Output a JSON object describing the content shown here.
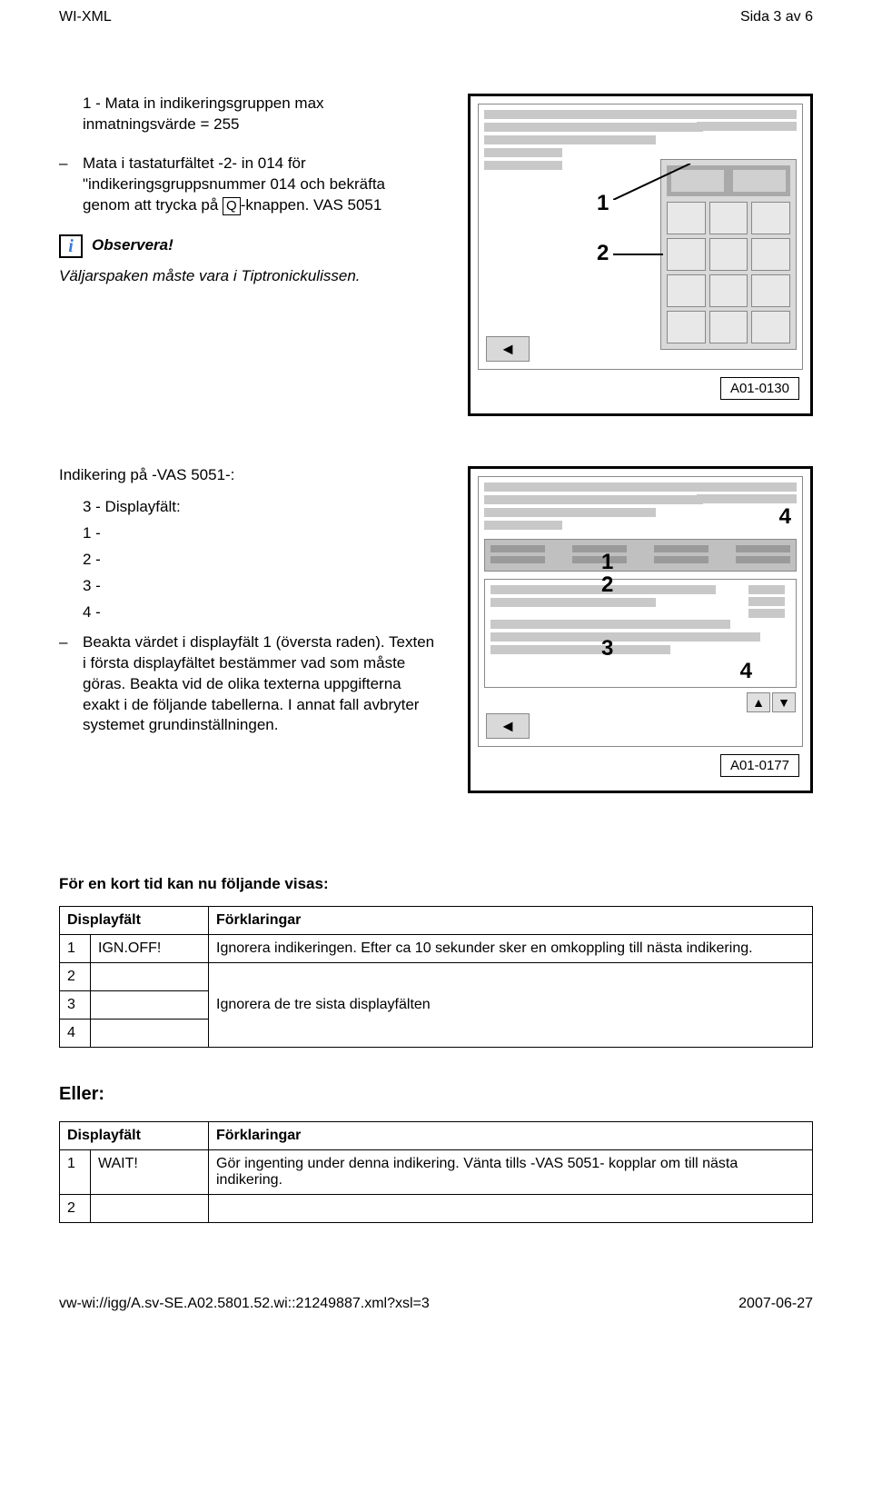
{
  "header": {
    "left": "WI-XML",
    "right": "Sida 3 av 6"
  },
  "block1": {
    "item1": "1 - Mata in indikeringsgruppen max inmatningsvärde = 255",
    "item2_pre": "Mata i tastaturfältet -2- in 014 för \"indikeringsgruppsnummer 014 och bekräfta genom att trycka på ",
    "item2_key": "Q",
    "item2_post": "-knappen. VAS 5051",
    "info_label": "Observera!",
    "info_note": "Väljarspaken måste vara i Tiptronickulissen."
  },
  "fig1_label": "A01-0130",
  "fig2_label": "A01-0177",
  "callout1": "1",
  "callout2": "2",
  "callout3": "3",
  "callout4": "4",
  "block2": {
    "heading": "Indikering på -VAS 5051-:",
    "lines": [
      "3 - Displayfält:",
      "1 -",
      "2 -",
      "3 -",
      "4 -"
    ],
    "para": "Beakta värdet i displayfält 1 (översta raden). Texten i första displayfältet bestämmer vad som måste göras. Beakta vid de olika texterna uppgifterna exakt i de följande tabellerna. I annat fall avbryter systemet grundinställningen."
  },
  "table1": {
    "heading": "För en kort tid kan nu följande visas:",
    "col1": "Displayfält",
    "col2": "Förklaringar",
    "rows": [
      {
        "n": "1",
        "v": "IGN.OFF!",
        "d": "Ignorera indikeringen. Efter ca 10 sekunder sker en omkoppling till nästa indikering."
      },
      {
        "n": "2",
        "v": "",
        "d": ""
      },
      {
        "n": "3",
        "v": "",
        "d": "Ignorera de tre sista displayfälten"
      },
      {
        "n": "4",
        "v": "",
        "d": ""
      }
    ]
  },
  "eller_heading": "Eller:",
  "table2": {
    "col1": "Displayfält",
    "col2": "Förklaringar",
    "rows": [
      {
        "n": "1",
        "v": "WAIT!",
        "d": "Gör ingenting under denna indikering. Vänta tills -VAS 5051- kopplar om till nästa indikering."
      },
      {
        "n": "2",
        "v": "",
        "d": ""
      }
    ]
  },
  "footer": {
    "left": "vw-wi://igg/A.sv-SE.A02.5801.52.wi::21249887.xml?xsl=3",
    "right": "2007-06-27"
  }
}
